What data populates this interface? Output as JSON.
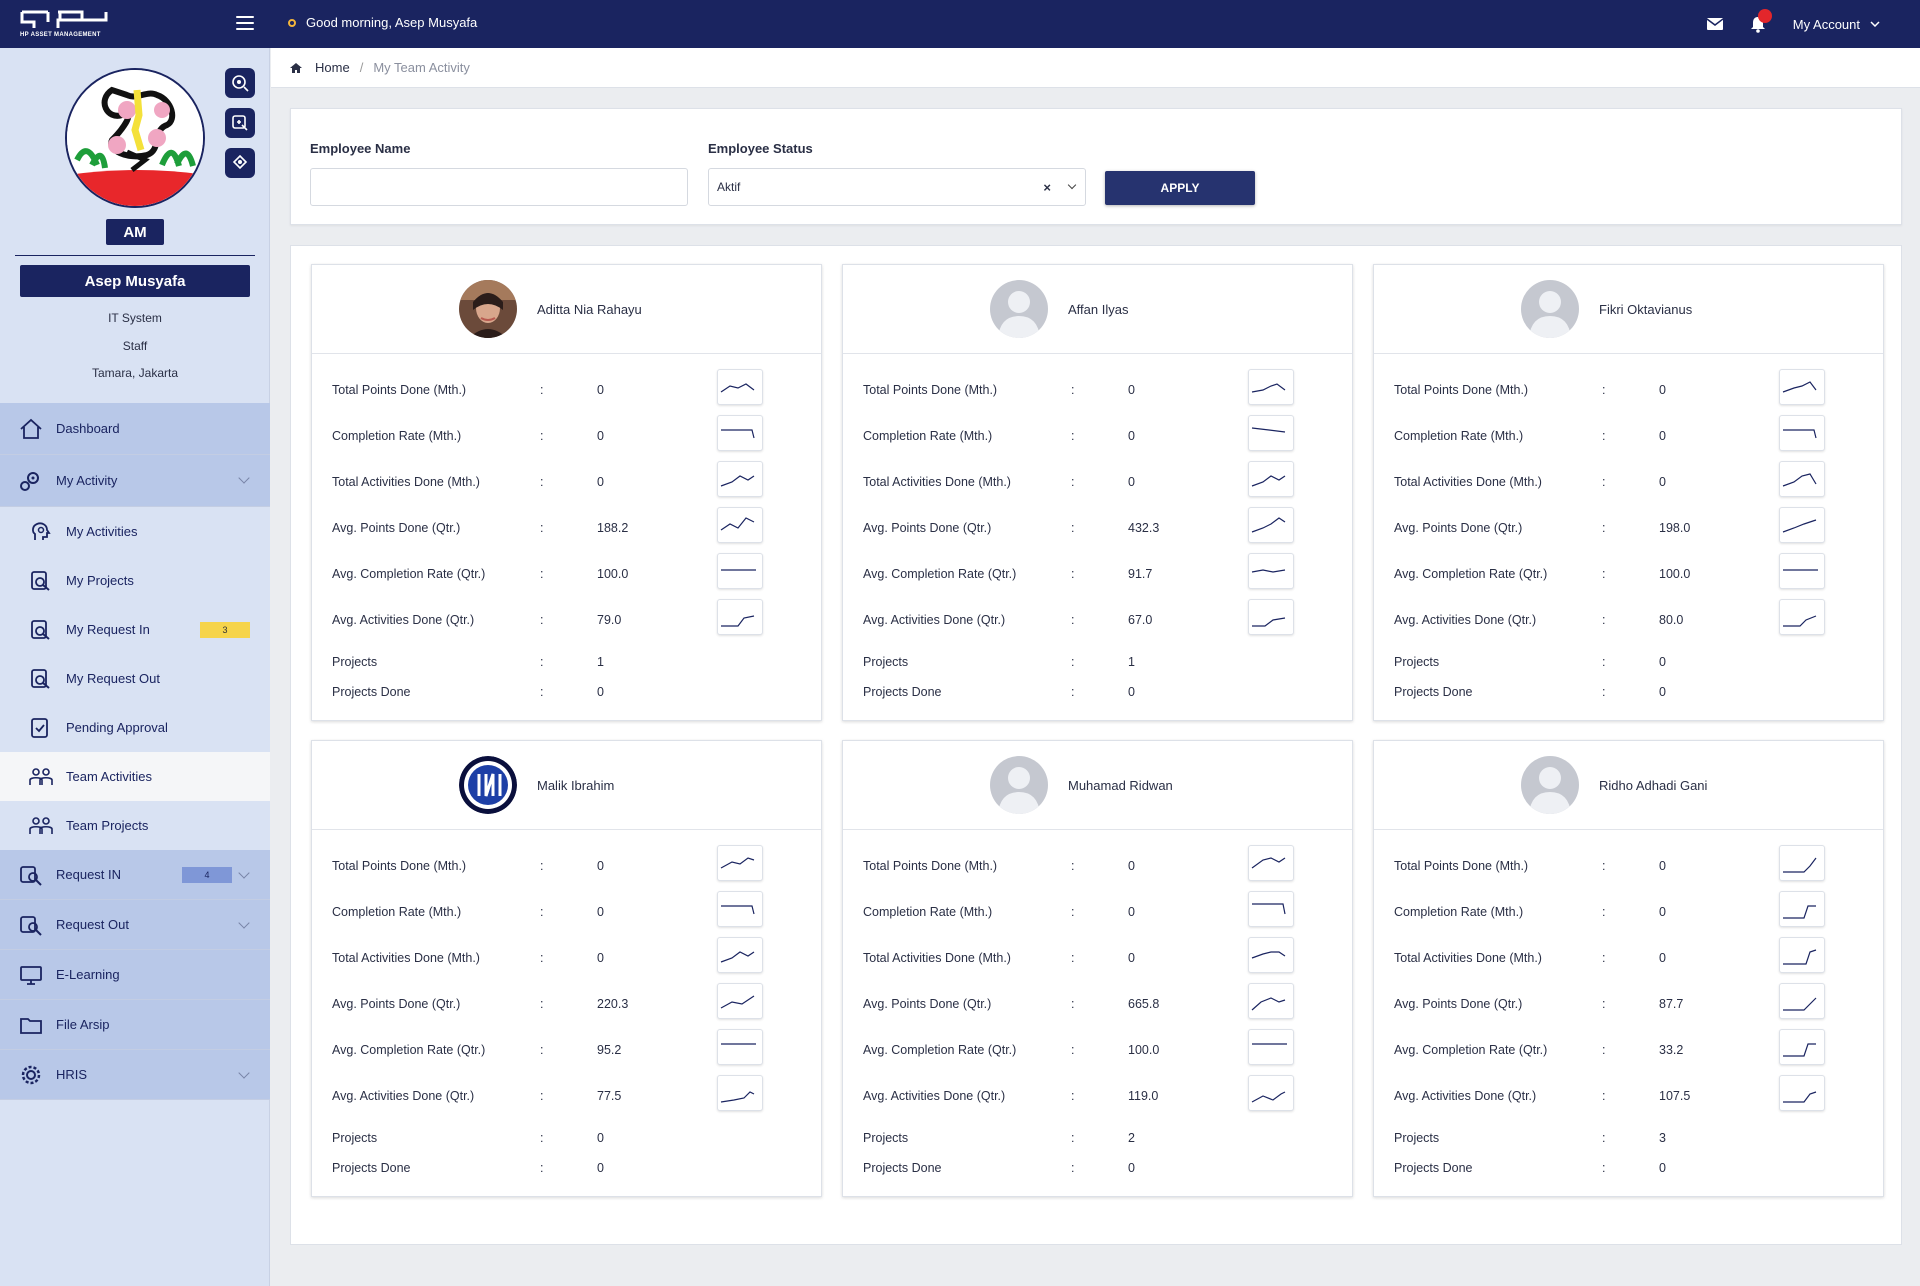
{
  "topbar": {
    "logo_text": "HP ASSET MANAGEMENT",
    "greeting": "Good morning, Asep Musyafa",
    "account_label": "My Account"
  },
  "profile": {
    "initials": "AM",
    "name": "Asep Musyafa",
    "department": "IT System",
    "role": "Staff",
    "location": "Tamara, Jakarta"
  },
  "nav": {
    "dashboard": "Dashboard",
    "my_activity": "My Activity",
    "my_activities": "My Activities",
    "my_projects": "My Projects",
    "my_request_in": "My Request In",
    "my_request_in_count": "3",
    "my_request_out": "My Request Out",
    "pending_approval": "Pending Approval",
    "team_activities": "Team Activities",
    "team_projects": "Team Projects",
    "request_in": "Request IN",
    "request_in_count": "4",
    "request_out": "Request Out",
    "elearning": "E-Learning",
    "file_arsip": "File Arsip",
    "hris": "HRIS"
  },
  "breadcrumb": {
    "home": "Home",
    "separator": "/",
    "current": "My Team Activity"
  },
  "filter": {
    "name_label": "Employee Name",
    "name_value": "",
    "status_label": "Employee Status",
    "status_value": "Aktif",
    "clear_symbol": "×",
    "apply_label": "APPLY"
  },
  "labels": {
    "tpm": "Total Points Done (Mth.)",
    "cr": "Completion Rate (Mth.)",
    "tad": "Total Activities Done (Mth.)",
    "apd": "Avg. Points Done (Qtr.)",
    "acr": "Avg. Completion Rate (Qtr.)",
    "aad": "Avg. Activities Done (Qtr.)",
    "projects": "Projects",
    "projects_done": "Projects Done",
    "colon": ":"
  },
  "employees": [
    {
      "name": "Aditta Nia Rahayu",
      "avatar": "photo",
      "tpm": "0",
      "cr": "0",
      "tad": "0",
      "apd": "188.2",
      "acr": "100.0",
      "aad": "79.0",
      "projects": "1",
      "projects_done": "0"
    },
    {
      "name": "Affan Ilyas",
      "avatar": "placeholder",
      "tpm": "0",
      "cr": "0",
      "tad": "0",
      "apd": "432.3",
      "acr": "91.7",
      "aad": "67.0",
      "projects": "1",
      "projects_done": "0"
    },
    {
      "name": "Fikri Oktavianus",
      "avatar": "placeholder",
      "tpm": "0",
      "cr": "0",
      "tad": "0",
      "apd": "198.0",
      "acr": "100.0",
      "aad": "80.0",
      "projects": "0",
      "projects_done": "0"
    },
    {
      "name": "Malik Ibrahim",
      "avatar": "logo",
      "tpm": "0",
      "cr": "0",
      "tad": "0",
      "apd": "220.3",
      "acr": "95.2",
      "aad": "77.5",
      "projects": "0",
      "projects_done": "0"
    },
    {
      "name": "Muhamad Ridwan",
      "avatar": "placeholder",
      "tpm": "0",
      "cr": "0",
      "tad": "0",
      "apd": "665.8",
      "acr": "100.0",
      "aad": "119.0",
      "projects": "2",
      "projects_done": "0"
    },
    {
      "name": "Ridho Adhadi Gani",
      "avatar": "placeholder",
      "tpm": "0",
      "cr": "0",
      "tad": "0",
      "apd": "87.7",
      "acr": "33.2",
      "aad": "107.5",
      "projects": "3",
      "projects_done": "0"
    }
  ],
  "colors": {
    "brand_navy": "#1a2460",
    "sidebar_bg": "#d9e2f3",
    "nav_bg": "#b8c8e8",
    "badge_yellow": "#f6d44a",
    "badge_blue": "#7f97d7",
    "notification_red": "#e3262b"
  }
}
